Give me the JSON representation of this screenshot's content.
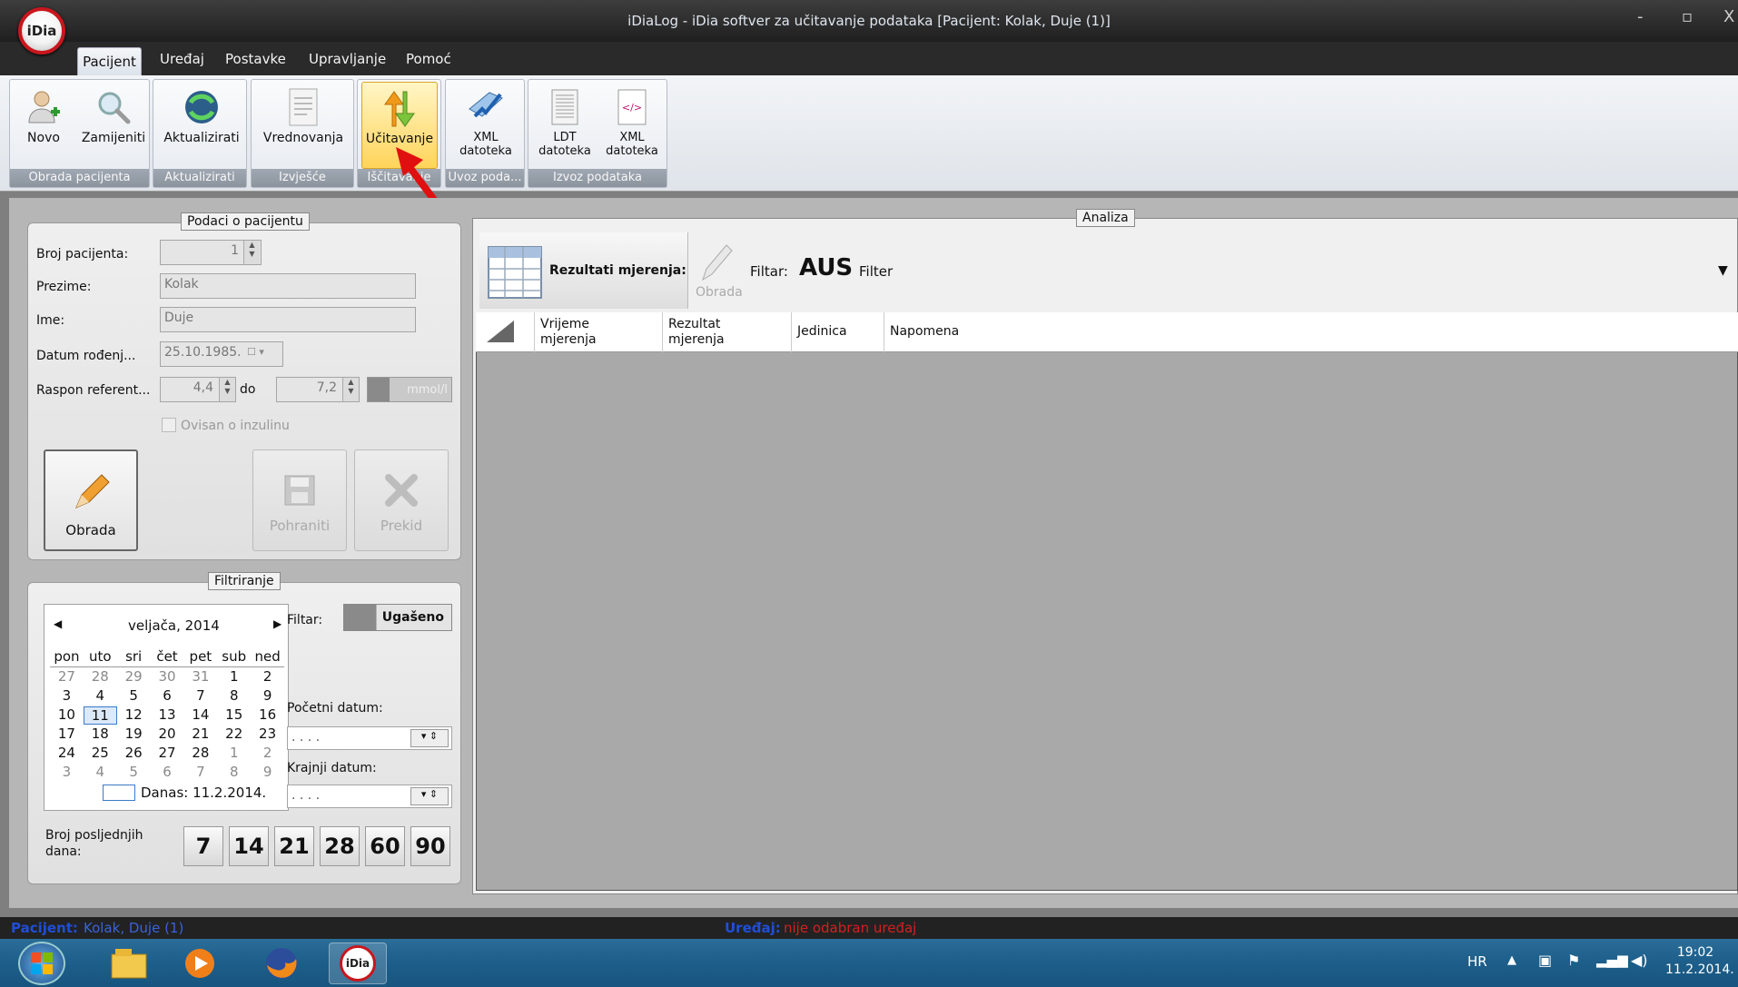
{
  "window": {
    "title": "iDiaLog - iDia softver za učitavanje podataka [Pacijent: Kolak, Duje (1)]",
    "logo_text": "iDia",
    "controls": [
      "-",
      "▫",
      "X"
    ]
  },
  "menu": [
    "Pacijent",
    "Uređaj",
    "Postavke",
    "Upravljanje",
    "Pomoć"
  ],
  "ribbon": {
    "buttons": {
      "novo": "Novo",
      "zamijeniti": "Zamijeniti",
      "aktualizirati": "Aktualizirati",
      "vrednovanja": "Vrednovanja",
      "ucitavanje": "Učitavanje",
      "xml_import_1": "XML",
      "xml_import_2": "datoteka",
      "ldt_1": "LDT",
      "ldt_2": "datoteka",
      "xml_export_1": "XML",
      "xml_export_2": "datoteka"
    },
    "groups": {
      "obrada": "Obrada pacijenta",
      "aktualizirati": "Aktualizirati",
      "izvjesce": "Izvješće",
      "iscitavanje": "Iščitavanje",
      "uvoz": "Uvoz poda...",
      "izvoz": "Izvoz podataka"
    }
  },
  "patient": {
    "legend": "Podaci o pacijentu",
    "broj_label": "Broj pacijenta:",
    "broj_value": "1",
    "prezime_label": "Prezime:",
    "prezime_value": "Kolak",
    "ime_label": "Ime:",
    "ime_value": "Duje",
    "datum_label": "Datum rođenj...",
    "datum_value": "25.10.1985.",
    "raspon_label": "Raspon referent...",
    "raspon_from": "4,4",
    "raspon_do": "do",
    "raspon_to": "7,2",
    "unit": "mmol/l",
    "ovisan_label": "Ovisan o inzulinu",
    "btn_obrada": "Obrada",
    "btn_pohraniti": "Pohraniti",
    "btn_prekid": "Prekid"
  },
  "filter": {
    "legend": "Filtriranje",
    "month_label": "veljača, 2014",
    "weekdays": [
      "pon",
      "uto",
      "sri",
      "čet",
      "pet",
      "sub",
      "ned"
    ],
    "weeks": [
      [
        "27",
        "28",
        "29",
        "30",
        "31",
        "1",
        "2"
      ],
      [
        "3",
        "4",
        "5",
        "6",
        "7",
        "8",
        "9"
      ],
      [
        "10",
        "11",
        "12",
        "13",
        "14",
        "15",
        "16"
      ],
      [
        "17",
        "18",
        "19",
        "20",
        "21",
        "22",
        "23"
      ],
      [
        "24",
        "25",
        "26",
        "27",
        "28",
        "1",
        "2"
      ],
      [
        "3",
        "4",
        "5",
        "6",
        "7",
        "8",
        "9"
      ]
    ],
    "today_label": "Danas: 11.2.2014.",
    "filtar_label": "Filtar:",
    "filtar_state": "Ugašeno",
    "pocetni_label": "Početni datum:",
    "pocetni_value": ". . . .",
    "krajnji_label": "Krajnji datum:",
    "krajnji_value": ". . . .",
    "broj_dana_label_1": "Broj posljednjih",
    "broj_dana_label_2": "dana:",
    "day_buttons": [
      "7",
      "14",
      "21",
      "28",
      "60",
      "90"
    ]
  },
  "analiza": {
    "legend": "Analiza",
    "rezultati_label": "Rezultati mjerenja:",
    "obrada_label": "Obrada",
    "filtar_label": "Filtar:",
    "filtar_value": "AUS",
    "filter_word": "Filter",
    "columns": {
      "vrijeme_1": "Vrijeme",
      "vrijeme_2": "mjerenja",
      "rezultat_1": "Rezultat",
      "rezultat_2": "mjerenja",
      "jedinica": "Jedinica",
      "napomena": "Napomena"
    }
  },
  "statusbar": {
    "pacijent_label": "Pacijent:",
    "pacijent_value": "Kolak, Duje (1)",
    "uredaj_label": "Uređaj:",
    "uredaj_value": "nije odabran uređaj"
  },
  "taskbar": {
    "lang": "HR",
    "time": "19:02",
    "date": "11.2.2014.",
    "app_icon_text": "iDia"
  },
  "colors": {
    "accent_red": "#e01010",
    "status_blue": "#1f4ed8",
    "status_red": "#d42020"
  }
}
